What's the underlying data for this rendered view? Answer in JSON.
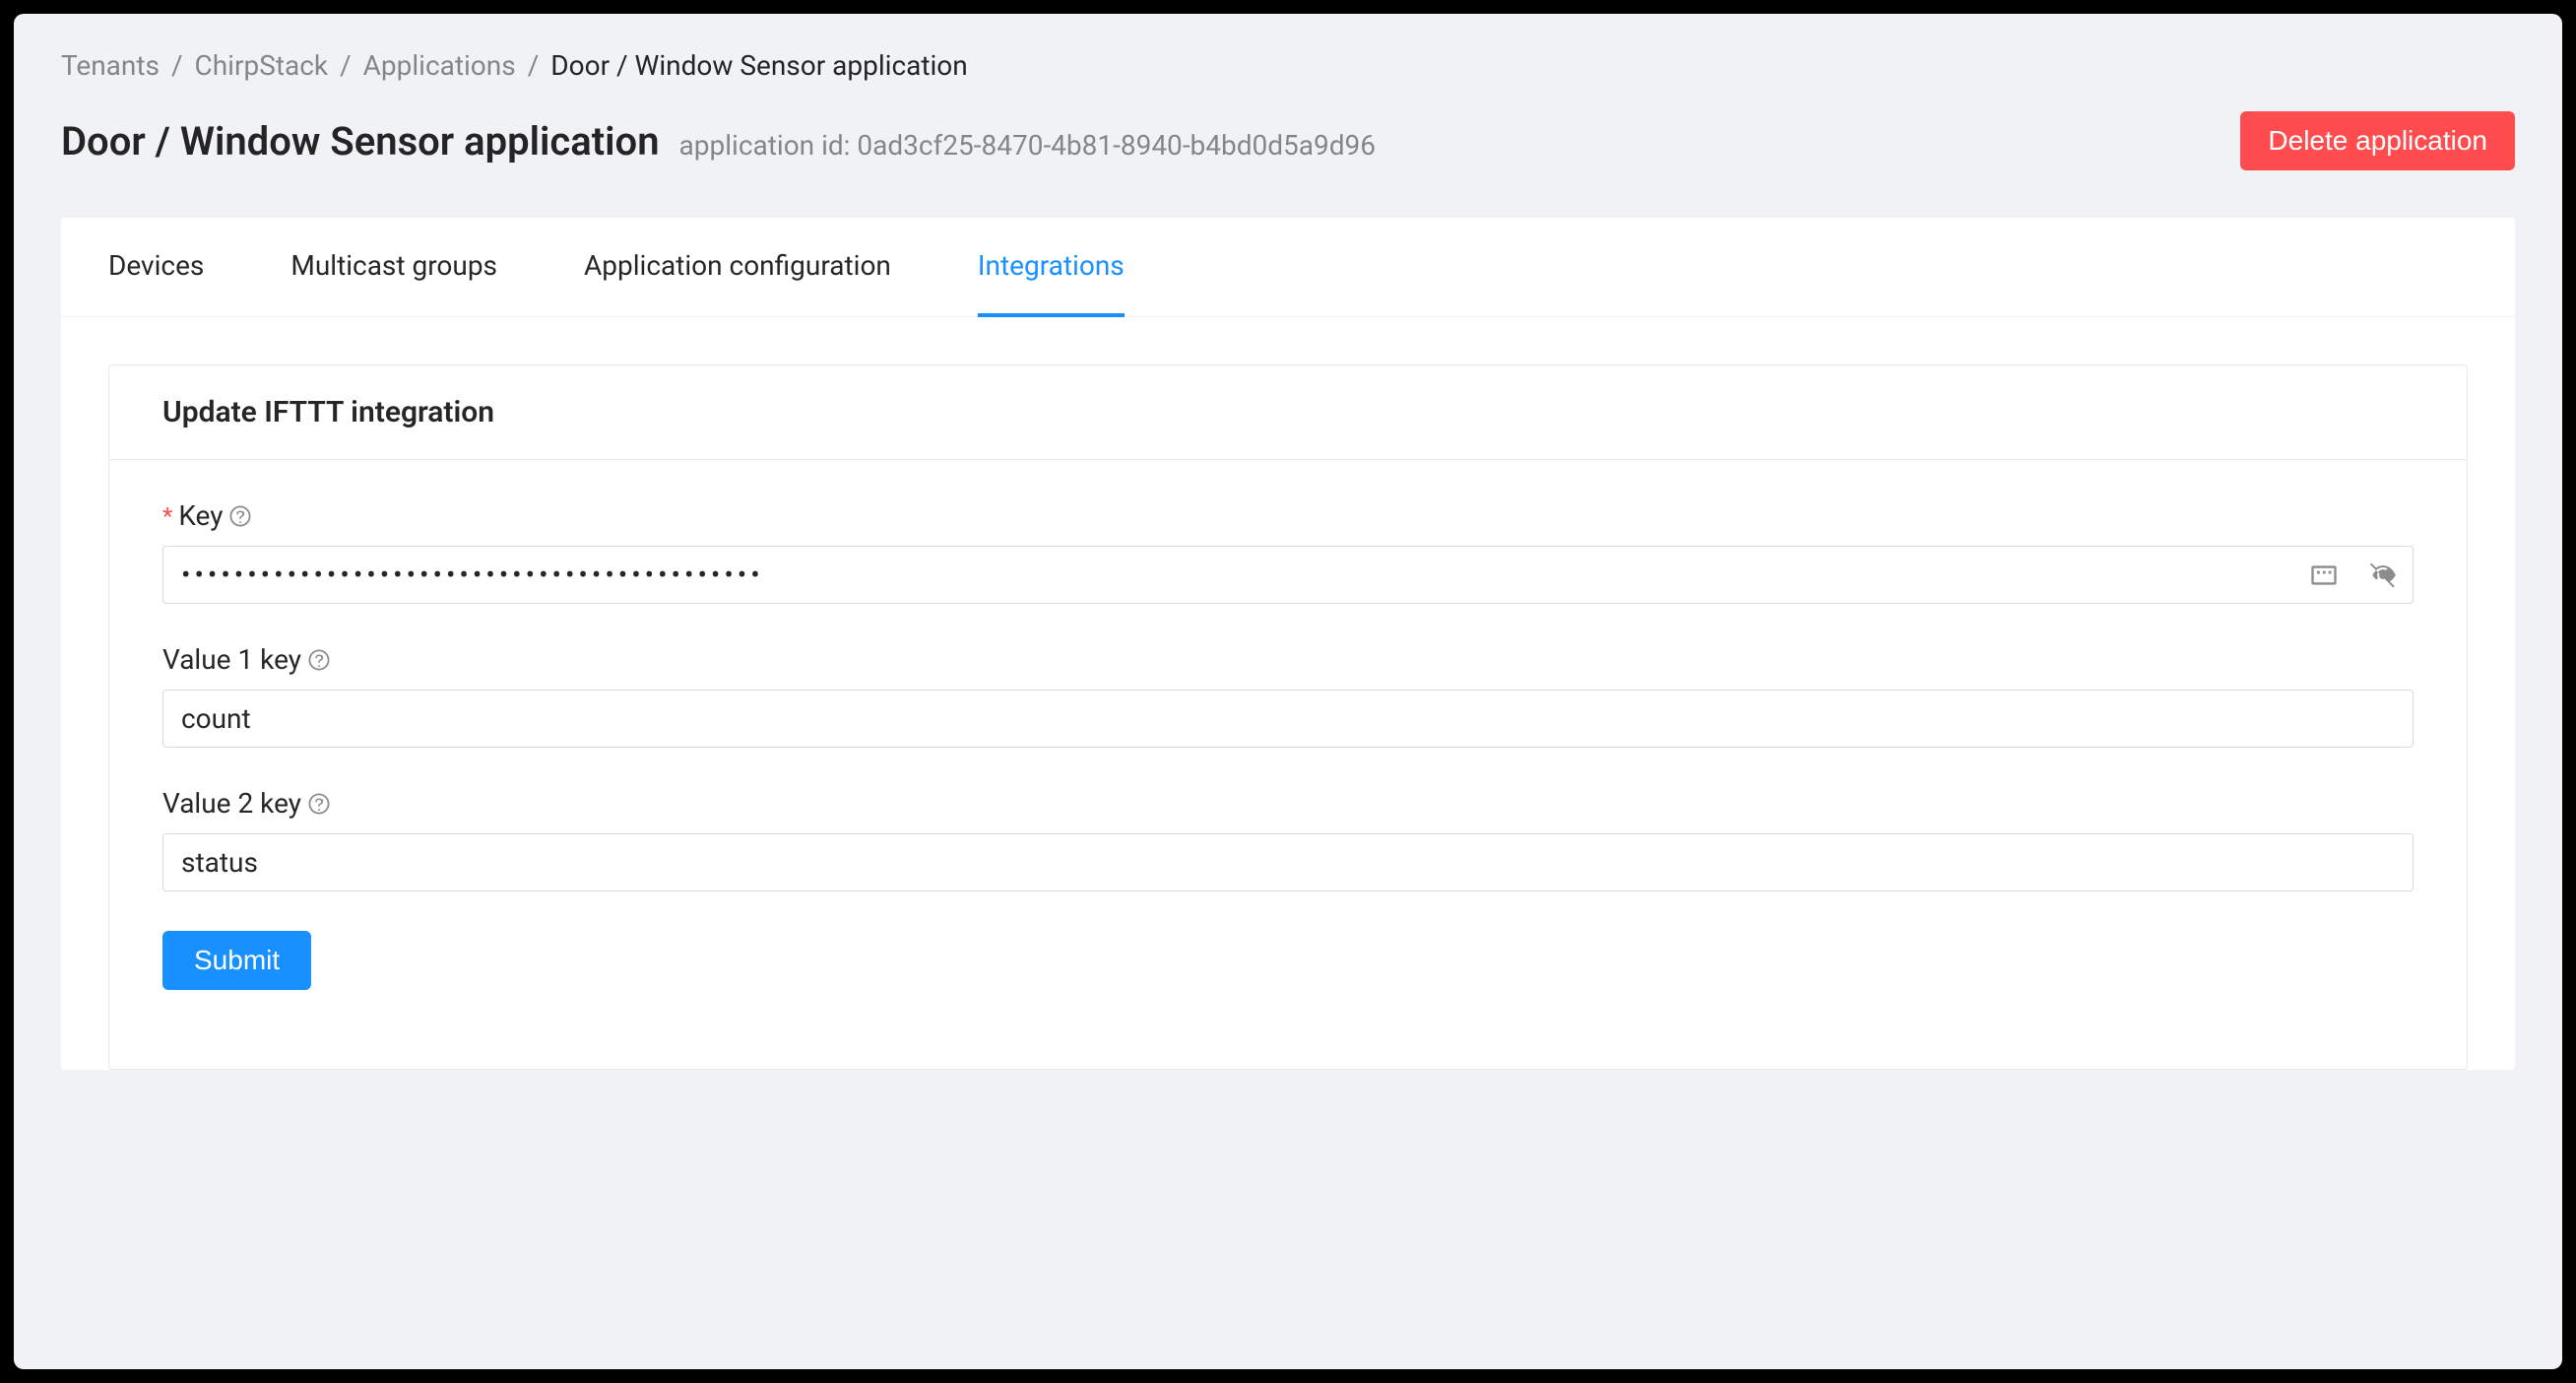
{
  "breadcrumb": {
    "items": [
      "Tenants",
      "ChirpStack",
      "Applications"
    ],
    "current": "Door / Window Sensor application"
  },
  "header": {
    "title": "Door / Window Sensor application",
    "app_id_label": "application id: 0ad3cf25-8470-4b81-8940-b4bd0d5a9d96",
    "delete_label": "Delete application"
  },
  "tabs": [
    {
      "label": "Devices",
      "active": false
    },
    {
      "label": "Multicast groups",
      "active": false
    },
    {
      "label": "Application configuration",
      "active": false
    },
    {
      "label": "Integrations",
      "active": true
    }
  ],
  "panel": {
    "title": "Update IFTTT integration"
  },
  "form": {
    "key": {
      "label": "Key",
      "required": true,
      "value": "••••••••••••••••••••••••••••••••••••••••••••"
    },
    "value1": {
      "label": "Value 1 key",
      "value": "count"
    },
    "value2": {
      "label": "Value 2 key",
      "value": "status"
    },
    "submit_label": "Submit"
  }
}
